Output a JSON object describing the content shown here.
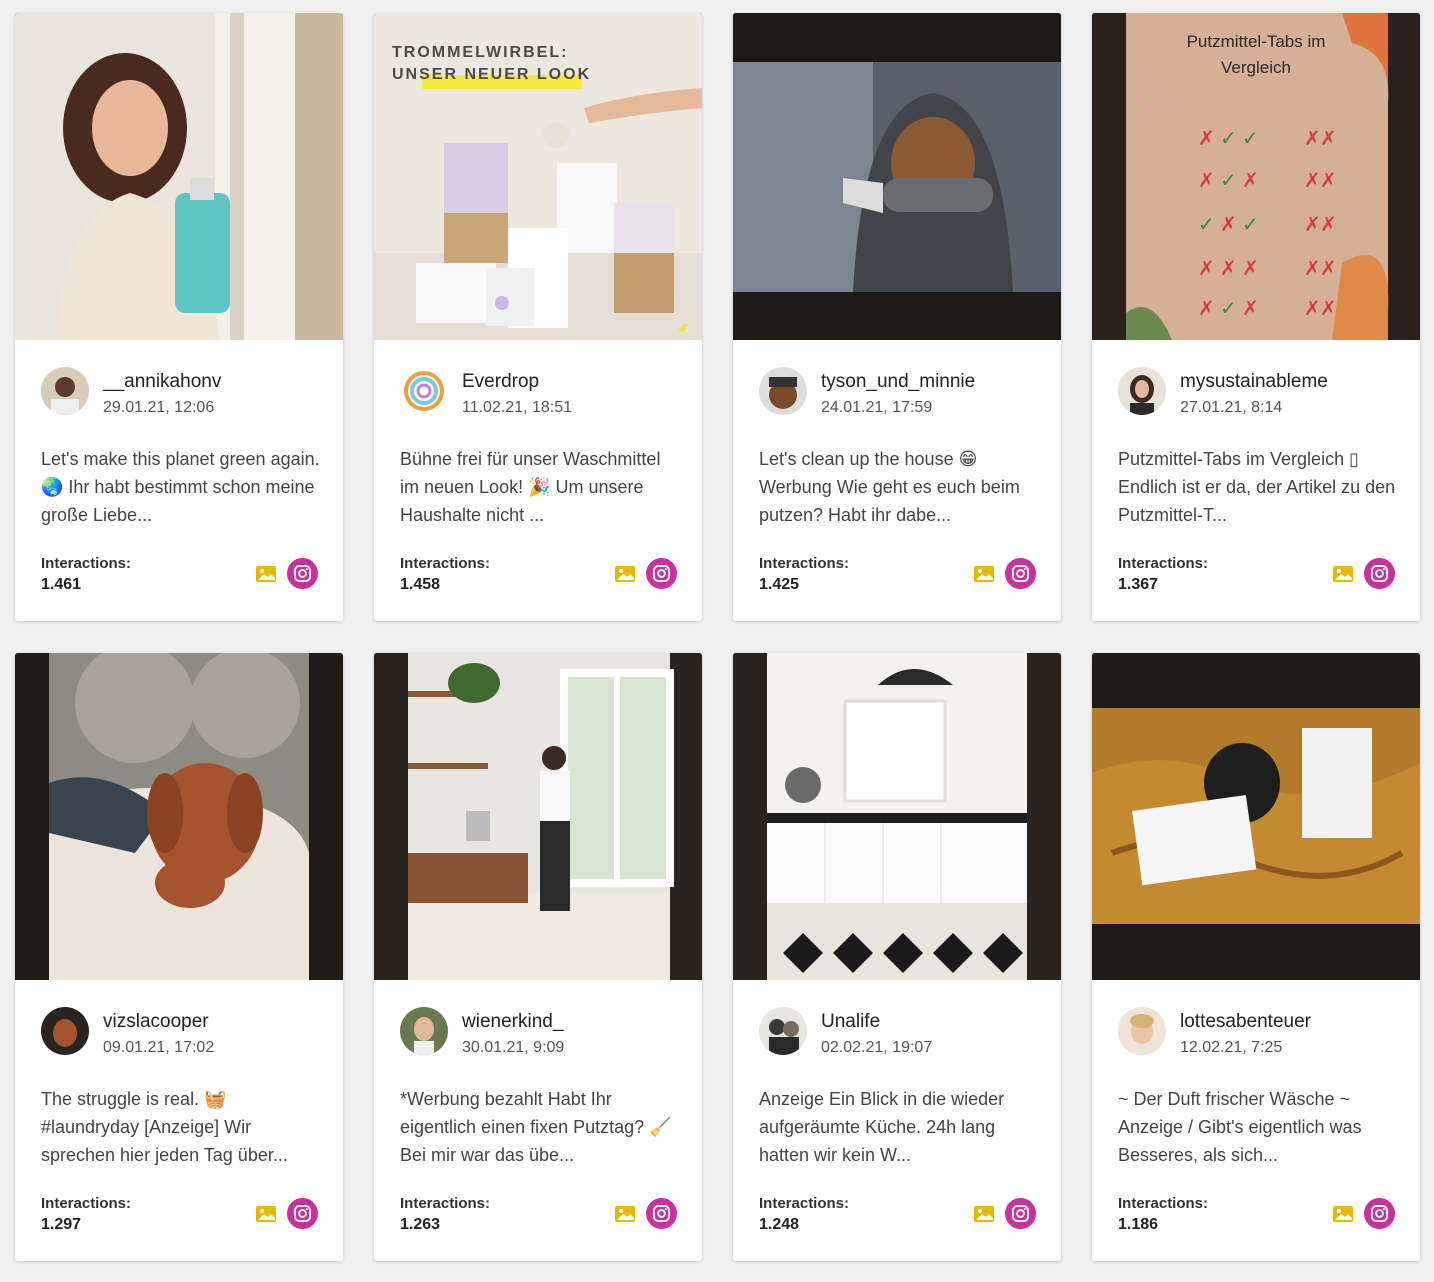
{
  "labels": {
    "interactions": "Interactions:"
  },
  "colors": {
    "instagram": "#c8309d",
    "image_icon": "#e6b800",
    "card_bg": "#ffffff",
    "page_bg": "#f0f0f0"
  },
  "posts": [
    {
      "user": "__annikahonv",
      "date": "29.01.21, 12:06",
      "caption": "Let's make this planet green again. 🌏 Ihr habt bestimmt schon meine große Liebe...",
      "interactions": "1.461",
      "image_icon": "image-icon",
      "platform_icon": "instagram-icon"
    },
    {
      "user": "Everdrop",
      "date": "11.02.21, 18:51",
      "caption": "Bühne frei für unser Waschmittel im neuen Look! 🎉 Um unsere Haushalte nicht ...",
      "interactions": "1.458",
      "image_icon": "image-icon",
      "platform_icon": "instagram-icon",
      "image_text": [
        "TROMMELWIRBEL:",
        "UNSER NEUER LOOK"
      ]
    },
    {
      "user": "tyson_und_minnie",
      "date": "24.01.21, 17:59",
      "caption": "Let's clean up the house 😁 Werbung Wie geht es euch beim putzen? Habt ihr dabe...",
      "interactions": "1.425",
      "image_icon": "image-icon",
      "platform_icon": "instagram-icon"
    },
    {
      "user": "mysustainableme",
      "date": "27.01.21, 8:14",
      "caption": "Putzmittel-Tabs im Vergleich ▯ Endlich ist er da, der Artikel zu den Putzmittel-T...",
      "interactions": "1.367",
      "image_icon": "image-icon",
      "platform_icon": "instagram-icon",
      "image_text": [
        "Putzmittel-Tabs im",
        "Vergleich"
      ]
    },
    {
      "user": "vizslacooper",
      "date": "09.01.21, 17:02",
      "caption": "The struggle is real. 🧺 #laundryday [Anzeige] Wir sprechen hier jeden Tag über...",
      "interactions": "1.297",
      "image_icon": "image-icon",
      "platform_icon": "instagram-icon"
    },
    {
      "user": "wienerkind_",
      "date": "30.01.21, 9:09",
      "caption": "*Werbung bezahlt Habt Ihr eigentlich einen fixen Putztag? 🧹 Bei mir war das übe...",
      "interactions": "1.263",
      "image_icon": "image-icon",
      "platform_icon": "instagram-icon"
    },
    {
      "user": "Unalife",
      "date": "02.02.21, 19:07",
      "caption": "Anzeige Ein Blick in die wieder aufgeräumte Küche. 24h lang hatten wir kein W...",
      "interactions": "1.248",
      "image_icon": "image-icon",
      "platform_icon": "instagram-icon"
    },
    {
      "user": "lottesabenteuer",
      "date": "12.02.21, 7:25",
      "caption": "~ Der Duft frischer Wäsche ~ Anzeige / Gibt's eigentlich was Besseres, als sich...",
      "interactions": "1.186",
      "image_icon": "image-icon",
      "platform_icon": "instagram-icon"
    }
  ]
}
